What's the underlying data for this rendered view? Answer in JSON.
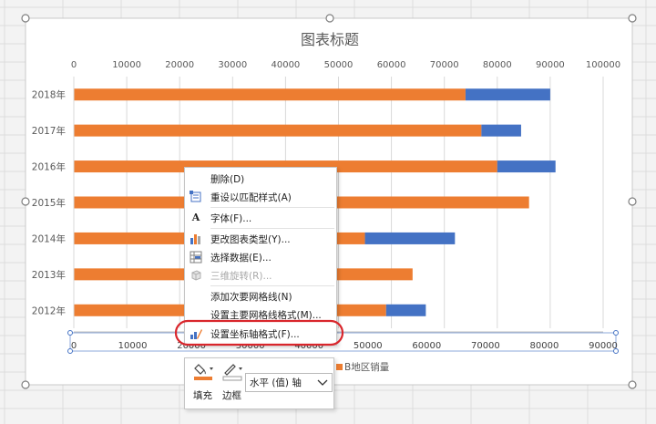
{
  "chart_data": {
    "type": "bar",
    "orientation": "horizontal",
    "stacked": true,
    "title": "图表标题",
    "categories": [
      "2012年",
      "2013年",
      "2014年",
      "2015年",
      "2016年",
      "2017年",
      "2018年"
    ],
    "series": [
      {
        "name": "",
        "color": "#ed7d31",
        "values": [
          59000,
          64000,
          55000,
          86000,
          80000,
          77000,
          74000
        ]
      },
      {
        "name": "",
        "color": "#4472c4",
        "values": [
          7500,
          0,
          17000,
          0,
          11000,
          7500,
          16000
        ]
      }
    ],
    "top_axis": {
      "min": 0,
      "max": 100000,
      "ticks": [
        0,
        10000,
        20000,
        30000,
        40000,
        50000,
        60000,
        70000,
        80000,
        90000,
        100000
      ]
    },
    "bottom_axis": {
      "min": 0,
      "max": 90000,
      "ticks": [
        0,
        10000,
        20000,
        30000,
        40000,
        50000,
        60000,
        70000,
        80000,
        90000
      ]
    },
    "legend": {
      "label": "B地区销量",
      "color": "#ed7d31",
      "placement": "bottom"
    },
    "grid": true
  },
  "context_menu": {
    "items": [
      {
        "label": "删除(D)",
        "icon": "",
        "disabled": false
      },
      {
        "label": "重设以匹配样式(A)",
        "icon": "reset-style-icon",
        "disabled": false
      },
      {
        "label": "字体(F)...",
        "icon": "font-icon",
        "disabled": false
      },
      {
        "label": "更改图表类型(Y)...",
        "icon": "chart-type-icon",
        "disabled": false
      },
      {
        "label": "选择数据(E)...",
        "icon": "select-data-icon",
        "disabled": false
      },
      {
        "label": "三维旋转(R)...",
        "icon": "3d-rotation-icon",
        "disabled": true
      },
      {
        "label": "添加次要网格线(N)",
        "icon": "",
        "disabled": false
      },
      {
        "label": "设置主要网格线格式(M)...",
        "icon": "",
        "disabled": false
      },
      {
        "label": "设置坐标轴格式(F)...",
        "icon": "format-axis-icon",
        "disabled": false
      }
    ],
    "highlight_color": "#d9262c"
  },
  "mini_toolbar": {
    "fill_label": "填充",
    "border_label": "边框",
    "element_selector": "水平 (值) 轴",
    "fill_color": "#ed7d31"
  }
}
